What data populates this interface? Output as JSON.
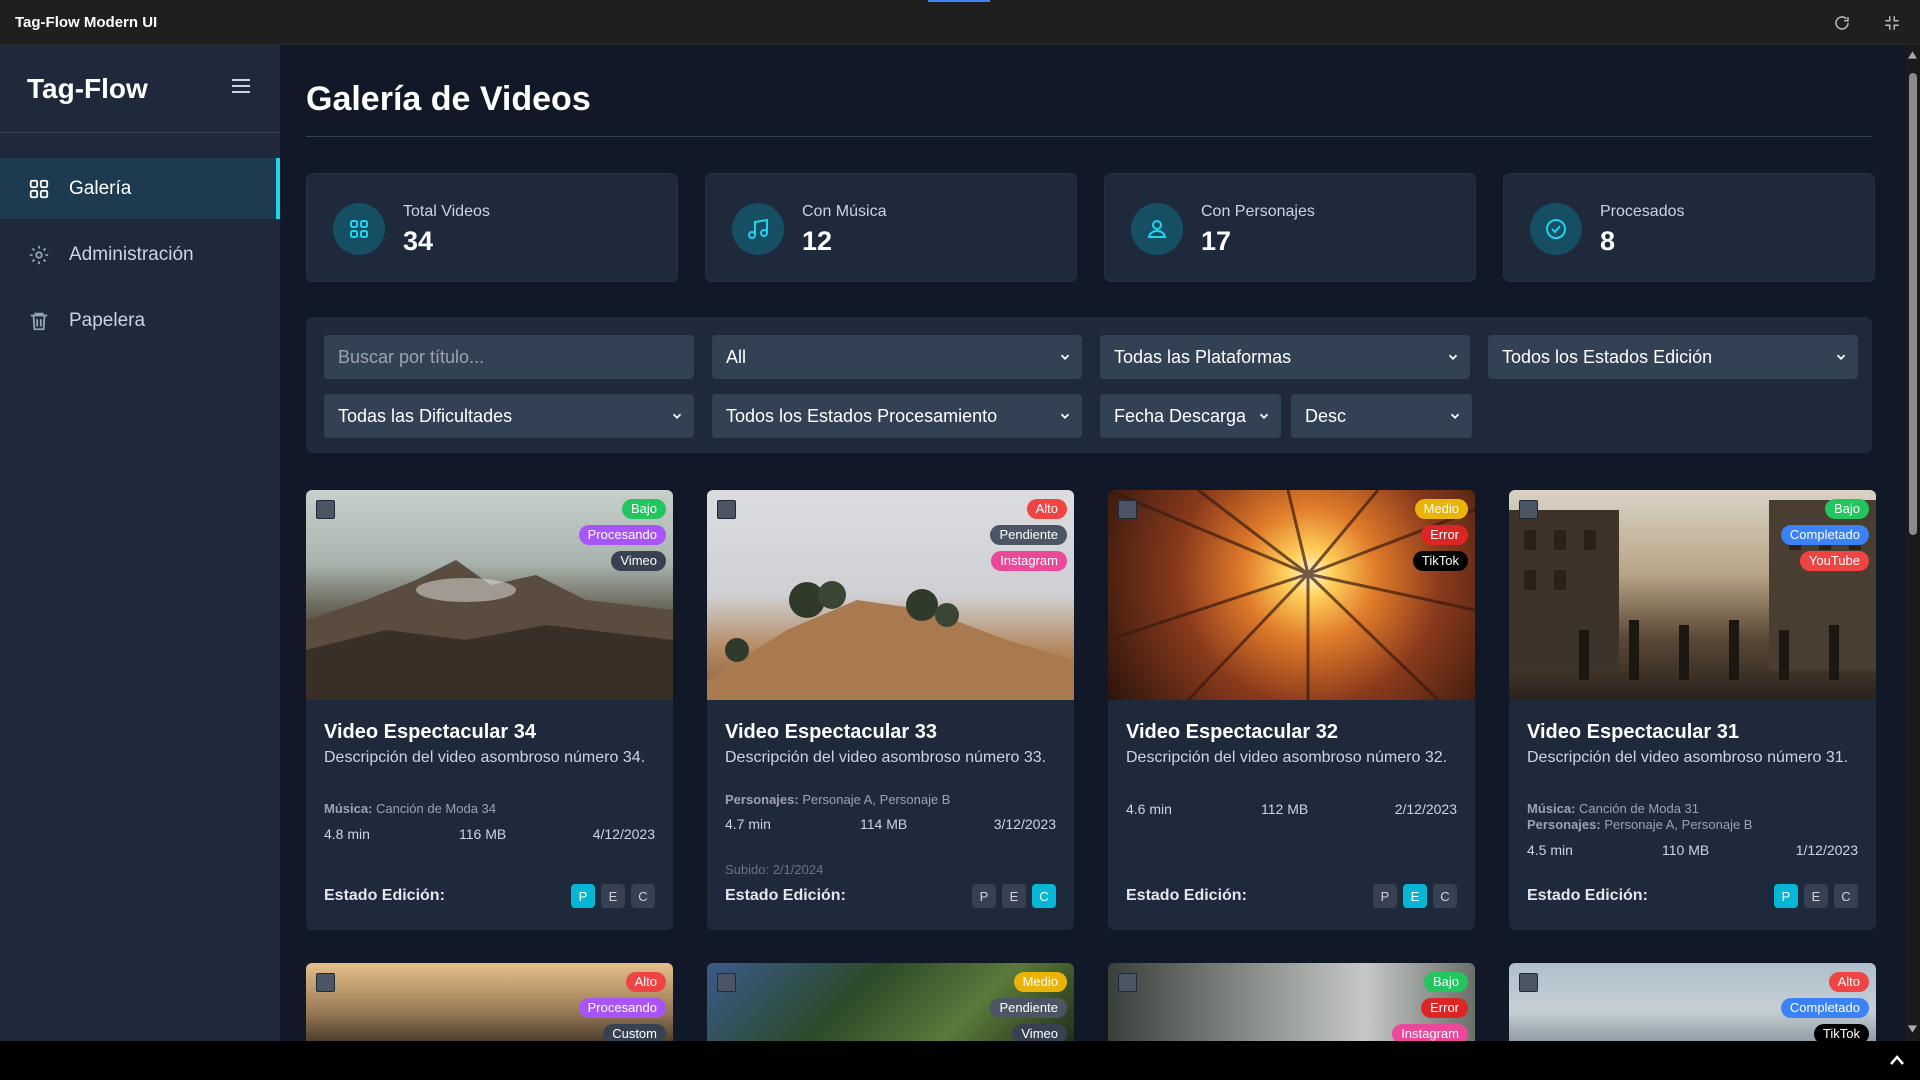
{
  "window": {
    "title": "Tag-Flow Modern UI",
    "refresh_icon": "refresh-icon",
    "minimize_icon": "compress-icon"
  },
  "sidebar": {
    "brand": "Tag-Flow",
    "items": [
      {
        "label": "Galería",
        "icon": "grid-icon",
        "active": true
      },
      {
        "label": "Administración",
        "icon": "gear-icon",
        "active": false
      },
      {
        "label": "Papelera",
        "icon": "trash-icon",
        "active": false
      }
    ]
  },
  "page": {
    "title": "Galería de Videos"
  },
  "stats": [
    {
      "label": "Total Videos",
      "value": "34",
      "icon": "grid-icon"
    },
    {
      "label": "Con Música",
      "value": "12",
      "icon": "music-icon"
    },
    {
      "label": "Con Personajes",
      "value": "17",
      "icon": "user-icon"
    },
    {
      "label": "Procesados",
      "value": "8",
      "icon": "check-circle-icon"
    }
  ],
  "filters": {
    "search_placeholder": "Buscar por título...",
    "creator": "All",
    "platform": "Todas las Plataformas",
    "edit_state": "Todos los Estados Edición",
    "difficulty": "Todas las Dificultades",
    "process_state": "Todos los Estados Procesamiento",
    "sort_by": "Fecha Descarga",
    "order": "Desc"
  },
  "cards": [
    {
      "title": "Video Espectacular 34",
      "desc": "Descripción del video asombroso número 34.",
      "music_label": "Música:",
      "music": "Canción de Moda 34",
      "duration": "4.8 min",
      "size": "116 MB",
      "date": "4/12/2023",
      "badges": [
        "Bajo",
        "Procesando",
        "Vimeo"
      ],
      "edit_label": "Estado Edición:",
      "pec": [
        "P",
        "E",
        "C"
      ],
      "active": 0
    },
    {
      "title": "Video Espectacular 33",
      "desc": "Descripción del video asombroso número 33.",
      "chars_label": "Personajes:",
      "chars": "Personaje A, Personaje B",
      "duration": "4.7 min",
      "size": "114 MB",
      "date": "3/12/2023",
      "uploaded": "Subido: 2/1/2024",
      "badges": [
        "Alto",
        "Pendiente",
        "Instagram"
      ],
      "edit_label": "Estado Edición:",
      "pec": [
        "P",
        "E",
        "C"
      ],
      "active": 2
    },
    {
      "title": "Video Espectacular 32",
      "desc": "Descripción del video asombroso número 32.",
      "duration": "4.6 min",
      "size": "112 MB",
      "date": "2/12/2023",
      "badges": [
        "Medio",
        "Error",
        "TikTok"
      ],
      "edit_label": "Estado Edición:",
      "pec": [
        "P",
        "E",
        "C"
      ],
      "active": 1
    },
    {
      "title": "Video Espectacular 31",
      "desc": "Descripción del video asombroso número 31.",
      "music_label": "Música:",
      "music": "Canción de Moda 31",
      "chars_label": "Personajes:",
      "chars": "Personaje A, Personaje B",
      "duration": "4.5 min",
      "size": "110 MB",
      "date": "1/12/2023",
      "badges": [
        "Bajo",
        "Completado",
        "YouTube"
      ],
      "edit_label": "Estado Edición:",
      "pec": [
        "P",
        "E",
        "C"
      ],
      "active": 0
    }
  ],
  "cards_row2": [
    {
      "badges": [
        "Alto",
        "Procesando",
        "Custom"
      ]
    },
    {
      "badges": [
        "Medio",
        "Pendiente",
        "Vimeo"
      ]
    },
    {
      "badges": [
        "Bajo",
        "Error",
        "Instagram"
      ]
    },
    {
      "badges": [
        "Alto",
        "Completado",
        "TikTok"
      ]
    }
  ],
  "colors": {
    "accent": "#22d3ee",
    "bajo": "#22c55e",
    "medio": "#eab308",
    "alto": "#ef4444",
    "procesando": "#a855f7",
    "pendiente": "#4b5563",
    "error": "#dc2626",
    "completado": "#3b82f6",
    "instagram": "#ec4899",
    "youtube": "#ef4444",
    "tiktok": "#000000",
    "vimeo": "#374151",
    "custom": "#374151"
  }
}
